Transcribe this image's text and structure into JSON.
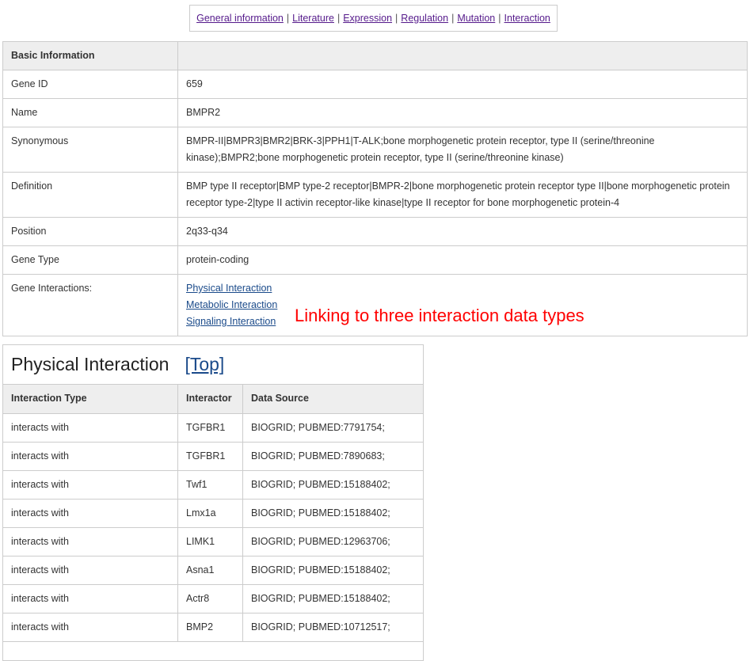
{
  "nav": {
    "items": [
      {
        "label": "General information"
      },
      {
        "label": "Literature"
      },
      {
        "label": "Expression"
      },
      {
        "label": "Regulation"
      },
      {
        "label": "Mutation"
      },
      {
        "label": "Interaction"
      }
    ],
    "separator": "|"
  },
  "basic": {
    "header": "Basic Information",
    "rows": {
      "gene_id": {
        "label": "Gene ID",
        "value": "659"
      },
      "name": {
        "label": "Name",
        "value": "BMPR2"
      },
      "synonymous": {
        "label": "Synonymous",
        "value": "BMPR-II|BMPR3|BMR2|BRK-3|PPH1|T-ALK;bone morphogenetic protein receptor, type II (serine/threonine kinase);BMPR2;bone morphogenetic protein receptor, type II (serine/threonine kinase)"
      },
      "definition": {
        "label": "Definition",
        "value": "BMP type II receptor|BMP type-2 receptor|BMPR-2|bone morphogenetic protein receptor type II|bone morphogenetic protein receptor type-2|type II activin receptor-like kinase|type II receptor for bone morphogenetic protein-4"
      },
      "position": {
        "label": "Position",
        "value": "2q33-q34"
      },
      "gene_type": {
        "label": "Gene Type",
        "value": "protein-coding"
      },
      "gene_interactions": {
        "label": "Gene Interactions:",
        "links": [
          "Physical Interaction",
          "Metabolic Interaction",
          "Signaling Interaction"
        ]
      }
    }
  },
  "annotation": {
    "text": "Linking to three interaction data types",
    "color": "#ff0000"
  },
  "physical": {
    "title": "Physical Interaction",
    "top_link": "[Top]",
    "columns": [
      "Interaction Type",
      "Interactor",
      "Data Source"
    ],
    "rows": [
      [
        "interacts with",
        "TGFBR1",
        "BIOGRID; PUBMED:7791754;"
      ],
      [
        "interacts with",
        "TGFBR1",
        "BIOGRID; PUBMED:7890683;"
      ],
      [
        "interacts with",
        "Twf1",
        "BIOGRID; PUBMED:15188402;"
      ],
      [
        "interacts with",
        "Lmx1a",
        "BIOGRID; PUBMED:15188402;"
      ],
      [
        "interacts with",
        "LIMK1",
        "BIOGRID; PUBMED:12963706;"
      ],
      [
        "interacts with",
        "Asna1",
        "BIOGRID; PUBMED:15188402;"
      ],
      [
        "interacts with",
        "Actr8",
        "BIOGRID; PUBMED:15188402;"
      ],
      [
        "interacts with",
        "BMP2",
        "BIOGRID; PUBMED:10712517;"
      ]
    ]
  }
}
